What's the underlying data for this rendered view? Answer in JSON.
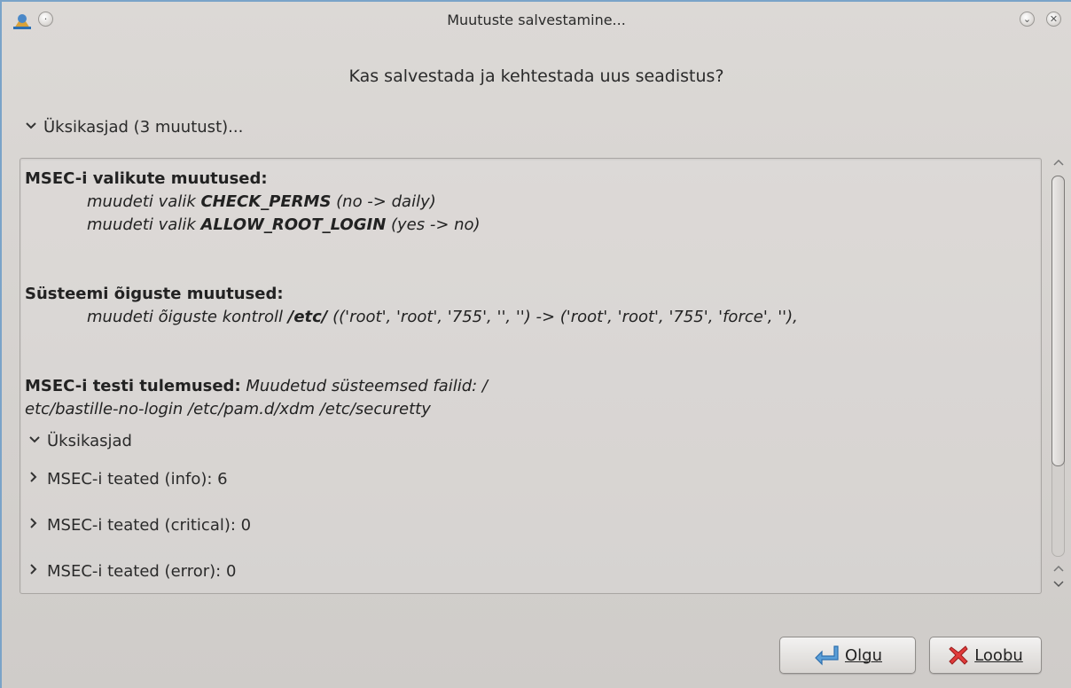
{
  "window": {
    "title": "Muutuste salvestamine...",
    "question": "Kas salvestada ja kehtestada uus seadistus?"
  },
  "details": {
    "toggle_label": "Üksikasjad (3 muutust)..."
  },
  "changes": {
    "msec_header": "MSEC-i valikute muutused:",
    "msec_lines": [
      {
        "prefix": "muudeti valik ",
        "option": "CHECK_PERMS",
        "suffix": " (no -> daily)"
      },
      {
        "prefix": "muudeti valik ",
        "option": "ALLOW_ROOT_LOGIN",
        "suffix": " (yes -> no)"
      }
    ],
    "perm_header": "Süsteemi õiguste muutused:",
    "perm_line": {
      "prefix": "muudeti õiguste kontroll ",
      "path": "/etc/",
      "suffix": " (('root', 'root', '755', '', '') -> ('root', 'root', '755', 'force', ''),"
    },
    "test_header": "MSEC-i testi tulemused:",
    "test_text_1": " Muudetud süsteemsed failid: /",
    "test_text_2": "etc/bastille-no-login /etc/pam.d/xdm /etc/securetty",
    "sub_details_label": "Üksikasjad",
    "sub_items": [
      "MSEC-i teated (info): 6",
      "MSEC-i teated (critical): 0",
      "MSEC-i teated (error): 0"
    ]
  },
  "buttons": {
    "ok_label": "Olgu",
    "cancel_label": "Loobu"
  },
  "icons": {
    "app": "mageia-security-icon",
    "ok": "ok-arrow-icon",
    "cancel": "red-x-icon"
  }
}
